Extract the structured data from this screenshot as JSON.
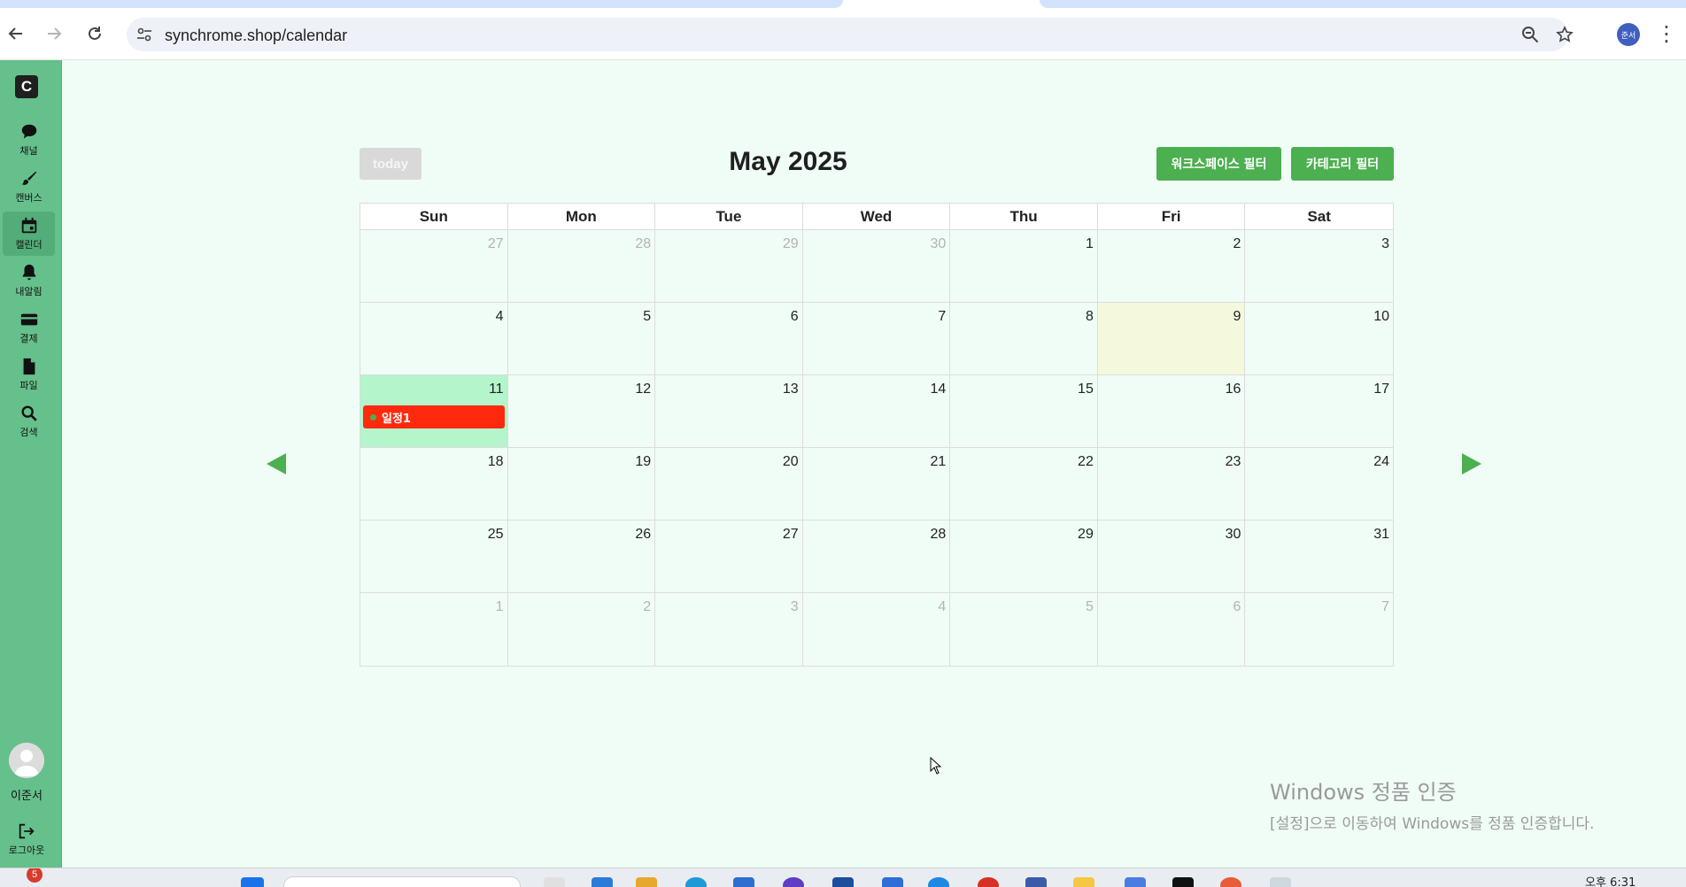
{
  "browser": {
    "url": "synchrome.shop/calendar",
    "profile_initials": "준서"
  },
  "sidebar": {
    "logo": "C",
    "items": [
      {
        "label": "채널",
        "icon": "chat-bubble-icon"
      },
      {
        "label": "캔버스",
        "icon": "brush-icon"
      },
      {
        "label": "캘린더",
        "icon": "calendar-icon"
      },
      {
        "label": "내알림",
        "icon": "bell-icon"
      },
      {
        "label": "결제",
        "icon": "credit-card-icon"
      },
      {
        "label": "파일",
        "icon": "file-icon"
      },
      {
        "label": "검색",
        "icon": "search-icon"
      }
    ],
    "active_item": "캘린더",
    "user_name": "이준서",
    "logout_label": "로그아웃"
  },
  "calendar": {
    "today_label": "today",
    "title": "May 2025",
    "workspace_filter_label": "워크스페이스 필터",
    "category_filter_label": "카테고리 필터",
    "weekdays": [
      "Sun",
      "Mon",
      "Tue",
      "Wed",
      "Thu",
      "Fri",
      "Sat"
    ],
    "weeks": [
      [
        "27",
        "28",
        "29",
        "30",
        "1",
        "2",
        "3"
      ],
      [
        "4",
        "5",
        "6",
        "7",
        "8",
        "9",
        "10"
      ],
      [
        "11",
        "12",
        "13",
        "14",
        "15",
        "16",
        "17"
      ],
      [
        "18",
        "19",
        "20",
        "21",
        "22",
        "23",
        "24"
      ],
      [
        "25",
        "26",
        "27",
        "28",
        "29",
        "30",
        "31"
      ],
      [
        "1",
        "2",
        "3",
        "4",
        "5",
        "6",
        "7"
      ]
    ],
    "today_date": "9",
    "selected_date": "11",
    "events": [
      {
        "date": "11",
        "title": "일정1",
        "color": "#ff2a0e"
      }
    ]
  },
  "watermark": {
    "title": "Windows 정품 인증",
    "subtitle": "[설정]으로 이동하여 Windows를 정품 인증합니다."
  },
  "taskbar": {
    "notification_count": "5",
    "clock": "오후 6:31"
  },
  "colors": {
    "sidebar": "#66c08c",
    "accent": "#4caf50",
    "event": "#ff2a0e",
    "selected_day": "#b4f5cb",
    "today_day": "#f5f9dc",
    "page_bg": "#f0fdf6"
  }
}
